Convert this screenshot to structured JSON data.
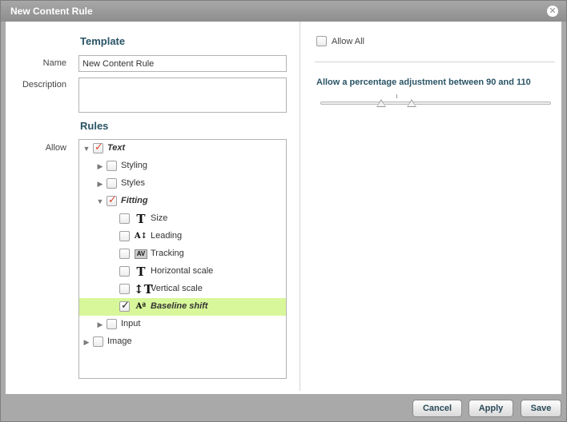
{
  "dialog": {
    "title": "New Content Rule",
    "close_icon": "close-icon"
  },
  "template": {
    "heading": "Template",
    "name_label": "Name",
    "name_value": "New Content Rule",
    "description_label": "Description",
    "description_value": ""
  },
  "rules": {
    "heading": "Rules",
    "allow_label": "Allow",
    "tree": [
      {
        "label": "Text",
        "level": 0,
        "expanded": true,
        "checked": true,
        "emphasis": true
      },
      {
        "label": "Styling",
        "level": 1,
        "expanded": false,
        "checked": false
      },
      {
        "label": "Styles",
        "level": 1,
        "expanded": false,
        "checked": false
      },
      {
        "label": "Fitting",
        "level": 1,
        "expanded": true,
        "checked": true,
        "emphasis": true
      },
      {
        "label": "Size",
        "level": 2,
        "checked": false,
        "icon": "font-size-icon"
      },
      {
        "label": "Leading",
        "level": 2,
        "checked": false,
        "icon": "leading-icon"
      },
      {
        "label": "Tracking",
        "level": 2,
        "checked": false,
        "icon": "tracking-icon"
      },
      {
        "label": "Horizontal scale",
        "level": 2,
        "checked": false,
        "icon": "horizontal-scale-icon"
      },
      {
        "label": "Vertical scale",
        "level": 2,
        "checked": false,
        "icon": "vertical-scale-icon"
      },
      {
        "label": "Baseline shift",
        "level": 2,
        "checked": true,
        "icon": "baseline-shift-icon",
        "selected": true
      },
      {
        "label": "Input",
        "level": 1,
        "expanded": false,
        "checked": false
      },
      {
        "label": "Image",
        "level": 0,
        "expanded": false,
        "checked": false
      }
    ]
  },
  "right_panel": {
    "allow_all_label": "Allow All",
    "allow_all_checked": false,
    "slider_text": "Allow a percentage adjustment between 90 and 110",
    "slider_min_value": 90,
    "slider_max_value": 110
  },
  "buttons": {
    "cancel": "Cancel",
    "apply": "Apply",
    "save": "Save"
  },
  "colors": {
    "heading": "#2a5466",
    "selected_row": "#d8f79a",
    "check_red": "#e0432a"
  }
}
